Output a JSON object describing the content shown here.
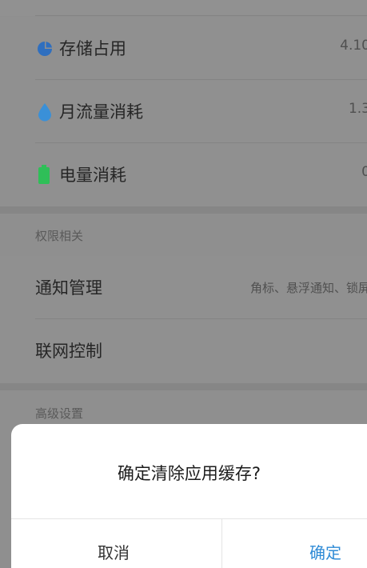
{
  "rows": [
    {
      "label": "存储占用",
      "value": "4.10"
    },
    {
      "label": "月流量消耗",
      "value": "1.3"
    },
    {
      "label": "电量消耗",
      "value": "0"
    }
  ],
  "permissions": {
    "section_title": "权限相关",
    "notification": {
      "label": "通知管理",
      "value": "角标、悬浮通知、锁屏"
    },
    "network": {
      "label": "联网控制"
    }
  },
  "advanced": {
    "section_title": "高级设置"
  },
  "dialog": {
    "title": "确定清除应用缓存?",
    "cancel_label": "取消",
    "confirm_label": "确定"
  },
  "colors": {
    "storage_icon": "#2f6fbf",
    "traffic_icon": "#3a90d8",
    "battery_icon": "#2fbf58",
    "confirm": "#2f8bd6"
  },
  "icons": [
    "pie-chart-icon",
    "water-drop-icon",
    "battery-icon"
  ]
}
